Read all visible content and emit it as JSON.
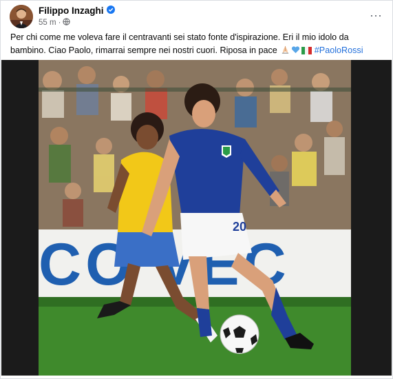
{
  "post": {
    "author": "Filippo Inzaghi",
    "time": "55 m",
    "separator": "·",
    "caption_main": "Per chi come me voleva fare il centravanti sei stato fonte d'ispirazione. Eri il mio idolo da bambino. Ciao Paolo, rimarrai sempre nei nostri cuori. Riposa in pace",
    "hashtag": "#PaoloRossi",
    "emojis": [
      "pray-emoji",
      "blue-heart-emoji",
      "italy-flag-emoji"
    ],
    "more_label": "···"
  },
  "photo": {
    "sign_text": "CO  VEC",
    "right_shorts_number": "20",
    "colors": {
      "italy_blue": "#1f3f9a",
      "brazil_yellow": "#f2c818",
      "grass": "#3f8a2c",
      "verified": "#1877f2"
    }
  }
}
